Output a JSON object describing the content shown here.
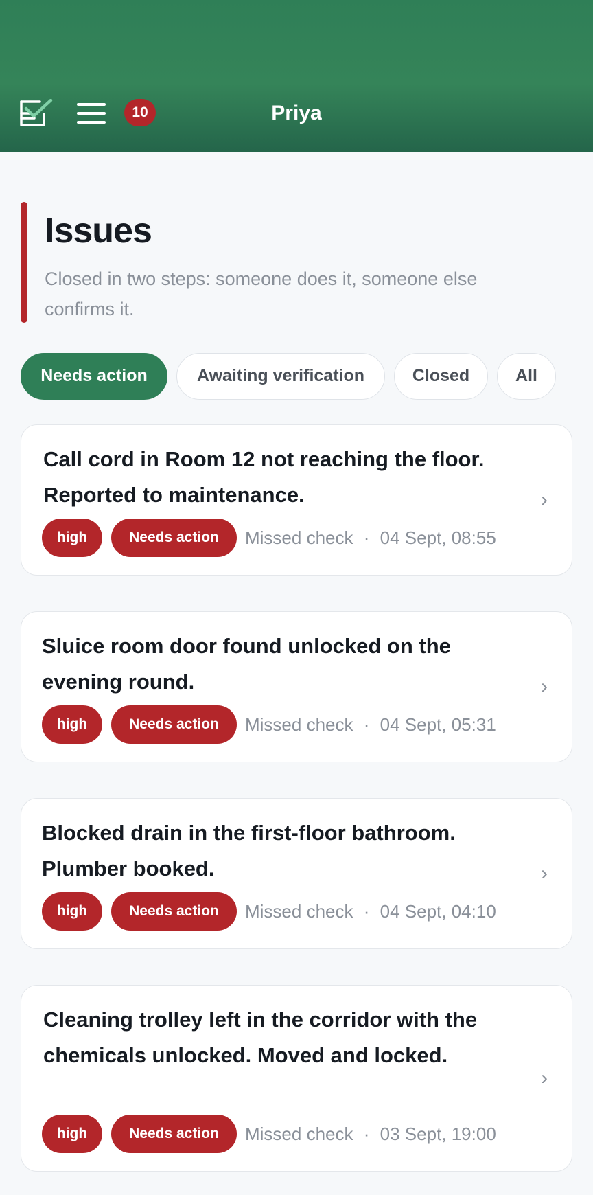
{
  "header": {
    "user_name": "Priya",
    "notification_count": "10",
    "app_icon": "checklist-icon",
    "menu_icon": "hamburger-menu-icon"
  },
  "page": {
    "title": "Issues",
    "subtitle": "Closed in two steps: someone does it, someone else confirms it."
  },
  "filters": [
    {
      "label": "Needs action",
      "active": true
    },
    {
      "label": "Awaiting verification",
      "active": false
    },
    {
      "label": "Closed",
      "active": false
    },
    {
      "label": "All",
      "active": false
    }
  ],
  "issues": [
    {
      "title": "Call cord in Room 12 not reaching the floor. Reported to maintenance.",
      "priority": "high",
      "status": "Needs action",
      "category": "Missed check",
      "separator": "·",
      "time": "04 Sept, 08:55"
    },
    {
      "title": "Sluice room door found unlocked on the evening round.",
      "priority": "high",
      "status": "Needs action",
      "category": "Missed check",
      "separator": "·",
      "time": "04 Sept, 05:31"
    },
    {
      "title": "Blocked drain in the first-floor bathroom. Plumber booked.",
      "priority": "high",
      "status": "Needs action",
      "category": "Missed check",
      "separator": "·",
      "time": "04 Sept, 04:10"
    },
    {
      "title": "Cleaning trolley left in the corridor with the chemicals unlocked. Moved and locked.",
      "priority": "high",
      "status": "Needs action",
      "category": "Missed check",
      "separator": "·",
      "time": "03 Sept, 19:00"
    }
  ],
  "colors": {
    "header_green": "#2f7f57",
    "alert_red": "#b3262a",
    "muted_text": "#8a9099",
    "page_bg": "#f6f8fa"
  },
  "icons": {
    "chevron": "chevron-right-icon"
  }
}
